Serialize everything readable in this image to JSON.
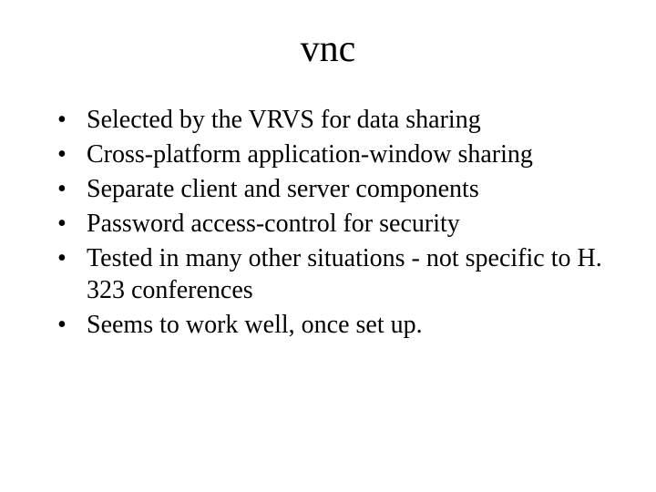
{
  "slide": {
    "title": "vnc",
    "bullets": [
      "Selected by the VRVS for data sharing",
      "Cross-platform application-window sharing",
      "Separate client and server components",
      "Password access-control for security",
      "Tested in many other situations - not specific to H. 323 conferences",
      "Seems to work well, once set up."
    ]
  }
}
